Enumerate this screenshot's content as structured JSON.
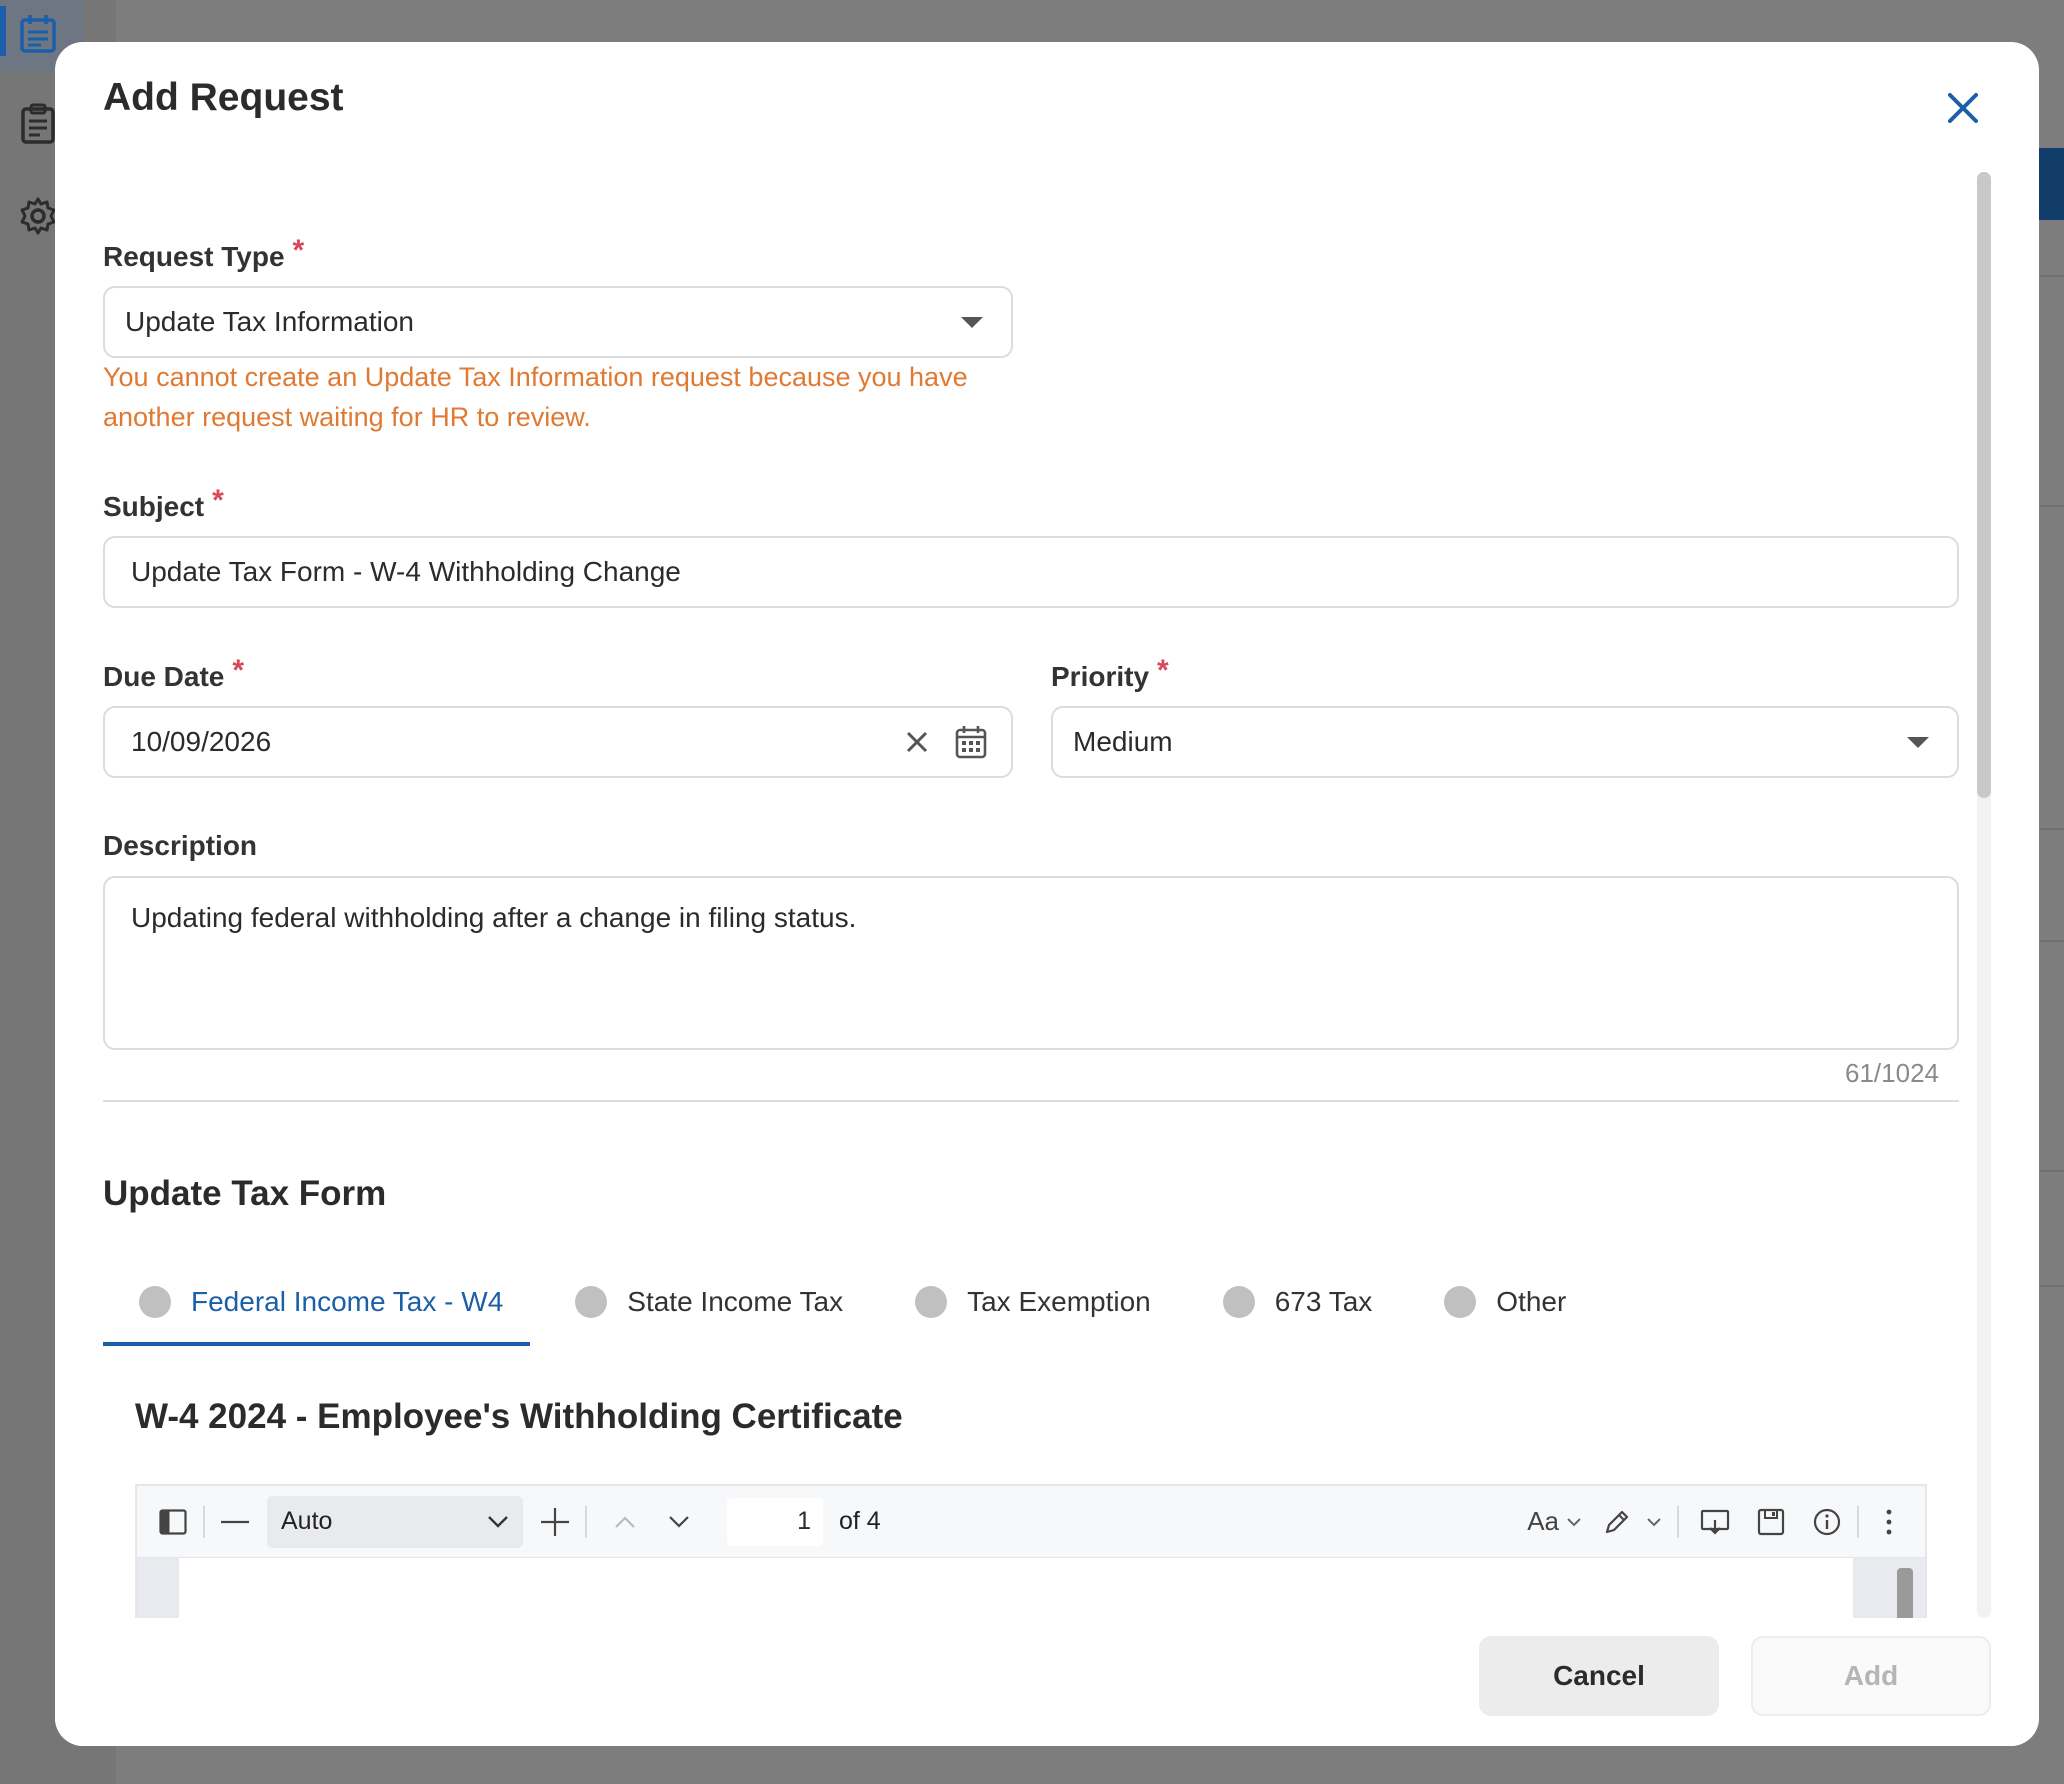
{
  "modal": {
    "title": "Add Request",
    "close_icon": "close-icon"
  },
  "request_type": {
    "label": "Request Type",
    "required_mark": "*",
    "value": "Update Tax Information",
    "warning": "You cannot create an Update Tax Information request because you have another request waiting for HR to review."
  },
  "subject": {
    "label": "Subject",
    "required_mark": "*",
    "value": "Update Tax Form - W-4 Withholding Change"
  },
  "due_date": {
    "label": "Due Date",
    "required_mark": "*",
    "value": "10/09/2026"
  },
  "priority": {
    "label": "Priority",
    "required_mark": "*",
    "value": "Medium"
  },
  "description": {
    "label": "Description",
    "value": "Updating federal withholding after a change in filing status.",
    "counter": "61/1024"
  },
  "tax_form": {
    "section_title": "Update Tax Form",
    "tabs": [
      {
        "label": "Federal Income Tax - W4",
        "active": true
      },
      {
        "label": "State Income Tax",
        "active": false
      },
      {
        "label": "Tax Exemption",
        "active": false
      },
      {
        "label": "673 Tax",
        "active": false
      },
      {
        "label": "Other",
        "active": false
      }
    ],
    "document_title": "W-4 2024 - Employee's Withholding Certificate"
  },
  "pdf_viewer": {
    "zoom": "Auto",
    "page_number": "1",
    "page_total": "of 4",
    "text_tool_label": "Aa"
  },
  "footer": {
    "cancel_label": "Cancel",
    "add_label": "Add"
  },
  "colors": {
    "accent": "#1b5fa8",
    "required": "#d9475a",
    "warning": "#e07a33"
  }
}
